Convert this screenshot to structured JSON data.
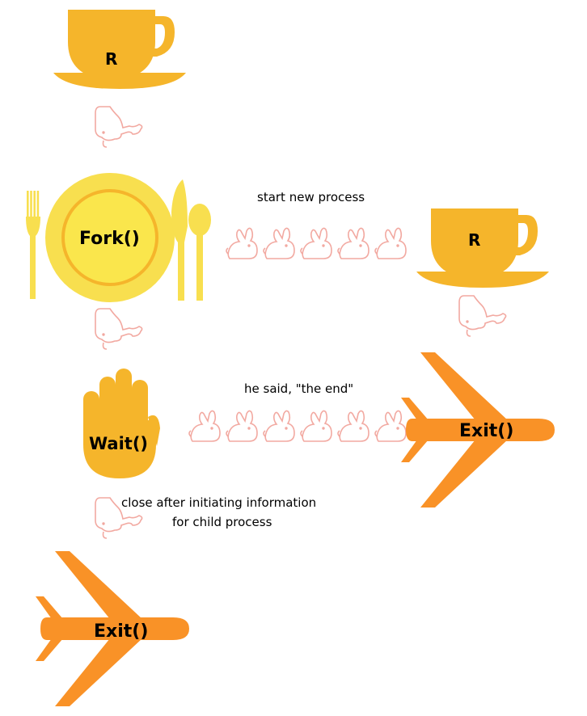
{
  "colors": {
    "cup": "#F5B52B",
    "plate": "#F8DF4F",
    "plate_center": "#FAE64C",
    "hand": "#F5B52B",
    "plane": "#F99227",
    "rabbit": "#F2A9A1"
  },
  "icons": {
    "cup": "teacup-icon",
    "place_setting": "plate-fork-knife-spoon-icon",
    "hand": "hand-icon",
    "plane": "airplane-icon",
    "rabbit": "rabbit-icon"
  },
  "nodes": {
    "parent_cup": {
      "label": "R"
    },
    "fork": {
      "label": "Fork()"
    },
    "child_cup": {
      "label": "R"
    },
    "wait": {
      "label": "Wait()"
    },
    "child_exit": {
      "label": "Exit()"
    },
    "parent_exit": {
      "label": "Exit()"
    }
  },
  "edges": {
    "fork_to_child": {
      "label": "start new process",
      "rabbits": 5
    },
    "exit_to_wait": {
      "label": "he said, \"the end\"",
      "rabbits": 6
    },
    "wait_to_exit": {
      "label_line1": "close after initiating information",
      "label_line2": "for child process",
      "rabbits": 1
    }
  }
}
